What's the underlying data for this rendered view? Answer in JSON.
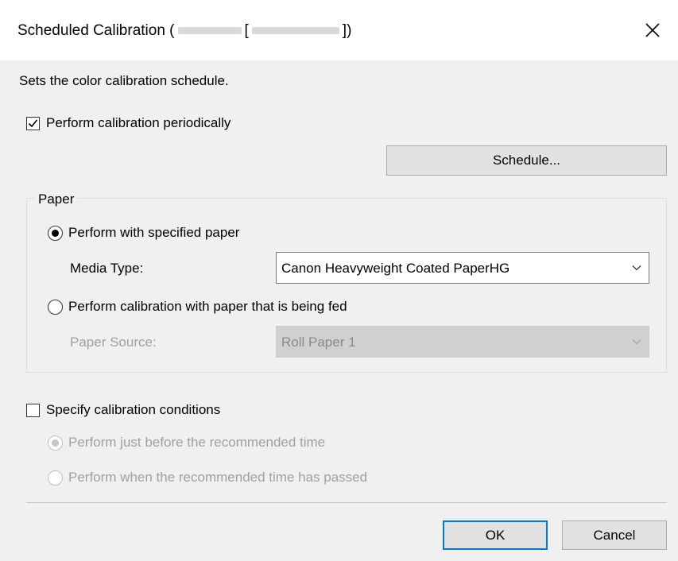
{
  "window": {
    "title_prefix": "Scheduled Calibration (",
    "title_mid": "[",
    "title_suffix": "])",
    "close_glyph": "×"
  },
  "description": "Sets the color calibration schedule.",
  "periodic": {
    "label": "Perform calibration periodically",
    "checked": true
  },
  "schedule_button": "Schedule...",
  "paper_group": {
    "label": "Paper",
    "specified": {
      "label": "Perform with specified paper",
      "selected": true
    },
    "media_type": {
      "label": "Media Type:",
      "value": "Canon Heavyweight Coated PaperHG"
    },
    "fed": {
      "label": "Perform calibration with paper that is being fed",
      "selected": false
    },
    "paper_source": {
      "label": "Paper Source:",
      "value": "Roll Paper 1"
    }
  },
  "conditions": {
    "label": "Specify calibration conditions",
    "checked": false,
    "before": "Perform just before the recommended time",
    "after": "Perform when the recommended time has passed"
  },
  "buttons": {
    "ok": "OK",
    "cancel": "Cancel"
  },
  "icons": {
    "close": "close-icon",
    "check": "checkmark-icon",
    "chevron": "chevron-down-icon"
  },
  "colors": {
    "accent": "#0078d7",
    "window_bg": "#f0f0f0",
    "title_bg": "#ffffff"
  }
}
